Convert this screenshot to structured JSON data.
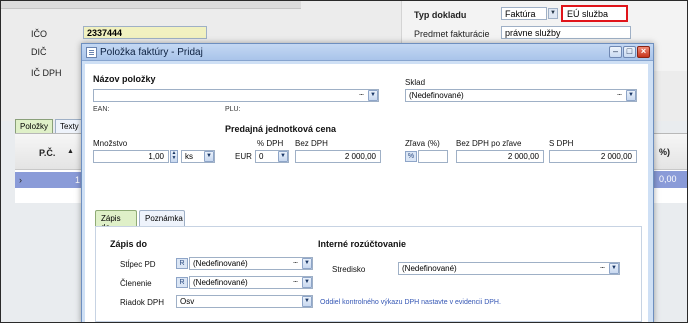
{
  "background": {
    "ico_label": "IČO",
    "ico_value": "2337444",
    "dic_label": "DIČ",
    "ic_dph_label": "IČ DPH",
    "typ_dokladu_label": "Typ dokladu",
    "typ_dokladu_value": "Faktúra",
    "eu_sluzba_value": "EÚ služba",
    "predmet_label": "Predmet fakturácie",
    "predmet_value": "právne služby",
    "tabs": [
      "Položky",
      "Texty"
    ],
    "grid_col_pc": "P.Č.",
    "grid_row_value": "1",
    "grid_pct_header": "%)",
    "grid_pct_value": "0,00"
  },
  "dialog": {
    "title": "Položka faktúry - Pridaj",
    "nazov_label": "Názov položky",
    "nazov_value": "",
    "ean_label": "EAN:",
    "plu_label": "PLU:",
    "sklad_label": "Sklad",
    "sklad_value": "(Nedefinované)",
    "predajna_label": "Predajná jednotková cena",
    "mnozstvo_label": "Množstvo",
    "mnozstvo_value": "1,00",
    "jednotka_value": "ks",
    "mena_label": "EUR",
    "dph_pct_label": "% DPH",
    "dph_pct_value": "0",
    "bez_dph_label": "Bez DPH",
    "bez_dph_value": "2 000,00",
    "zlava_label": "Zľava (%)",
    "zlava_btn": "%",
    "bez_dph_po_zlave_label": "Bez DPH po zľave",
    "bez_dph_po_zlave_value": "2 000,00",
    "s_dph_label": "S DPH",
    "s_dph_value": "2 000,00",
    "tabs": [
      "Zápis do",
      "Poznámka"
    ],
    "zapis_do_header": "Zápis do",
    "interne_header": "Interné rozúčtovanie",
    "stlpec_pd_label": "Stĺpec PD",
    "stlpec_pd_value": "(Nedefinované)",
    "clenenie_label": "Členenie",
    "clenenie_value": "(Nedefinované)",
    "riadok_dph_label": "Riadok DPH",
    "riadok_dph_value": "Osv",
    "stredisko_label": "Stredisko",
    "stredisko_value": "(Nedefinované)",
    "note_text": "Oddiel kontrolného výkazu DPH nastavte v evidencii DPH."
  }
}
